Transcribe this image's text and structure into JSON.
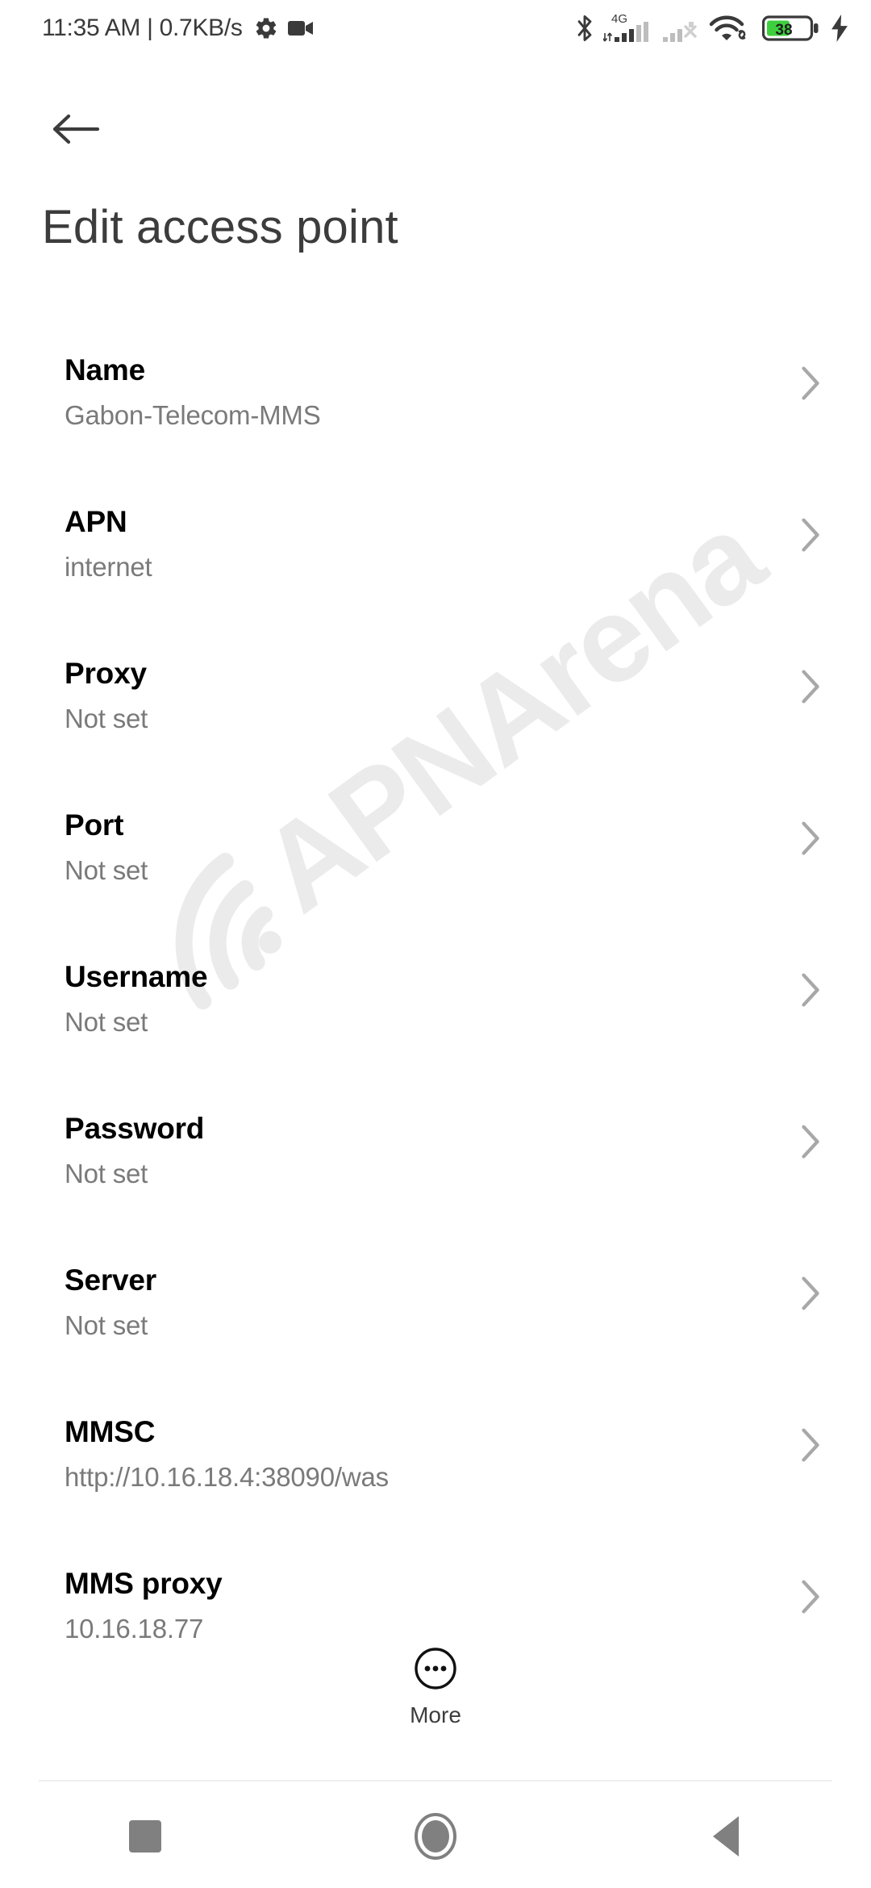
{
  "statusbar": {
    "time": "11:35 AM",
    "separator": "|",
    "network_speed": "0.7KB/s",
    "icons_left": [
      "gear-icon",
      "video-camera-icon"
    ],
    "icons_right": [
      "bluetooth-icon",
      "signal-4g-icon",
      "signal-sim2-off-icon",
      "wifi-link-icon",
      "battery-icon",
      "charging-bolt-icon"
    ],
    "network_type": "4G",
    "battery_level": "38",
    "battery_color": "#3ecf3e"
  },
  "header": {
    "back_icon": "arrow-left-icon",
    "title": "Edit access point"
  },
  "watermark": {
    "text": "APNArena",
    "color": "#ebebeb"
  },
  "list": {
    "rows": [
      {
        "label": "Name",
        "value": "Gabon-Telecom-MMS"
      },
      {
        "label": "APN",
        "value": "internet"
      },
      {
        "label": "Proxy",
        "value": "Not set"
      },
      {
        "label": "Port",
        "value": "Not set"
      },
      {
        "label": "Username",
        "value": "Not set"
      },
      {
        "label": "Password",
        "value": "Not set"
      },
      {
        "label": "Server",
        "value": "Not set"
      },
      {
        "label": "MMSC",
        "value": "http://10.16.18.4:38090/was"
      },
      {
        "label": "MMS proxy",
        "value": "10.16.18.77"
      }
    ]
  },
  "more": {
    "label": "More",
    "icon": "ellipsis-circle-icon"
  },
  "navbar": {
    "recents_label": "recents-square-icon",
    "home_label": "home-circle-icon",
    "back_label": "back-triangle-icon"
  }
}
